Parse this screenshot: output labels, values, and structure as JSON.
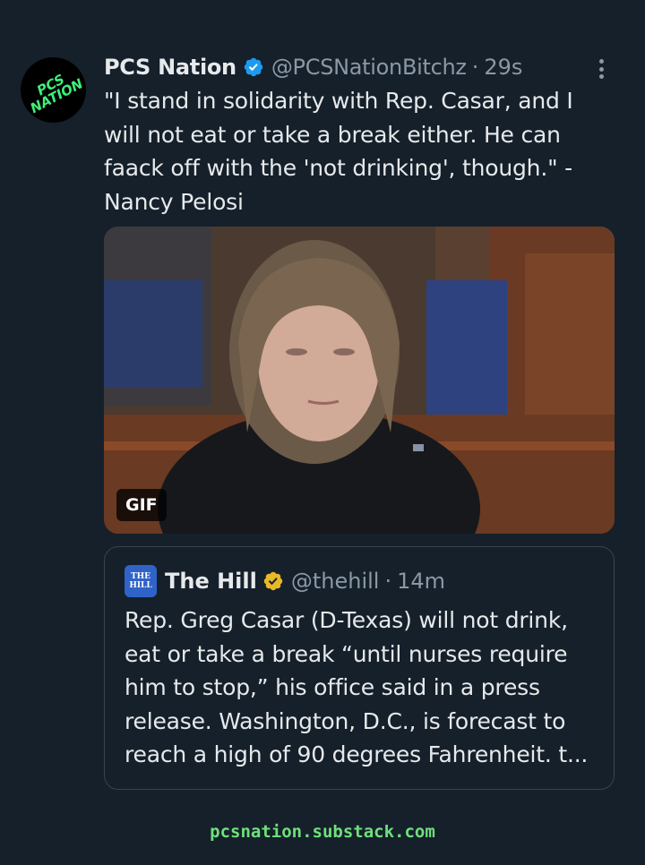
{
  "tweet": {
    "avatar_text": "PCS\nNATION",
    "display_name": "PCS Nation",
    "handle": "@PCSNationBitchz",
    "separator": "·",
    "time": "29s",
    "verified_color": "#1d9bf0",
    "text": "\"I stand in solidarity with Rep. Casar, and I will not eat or take a break either. He can faack off with the 'not drinking', though.\" - Nancy Pelosi",
    "media_badge": "GIF"
  },
  "quoted_tweet": {
    "avatar_text_top": "THE",
    "avatar_text_bottom": "HILL",
    "display_name": "The Hill",
    "handle": "@thehill",
    "separator": "·",
    "time": "14m",
    "verified_color": "#e8b829",
    "text": "Rep. Greg Casar (D-Texas) will not drink, eat or take a break “until nurses require him to stop,” his office said in a press release. Washington, D.C., is forecast to reach a high of 90 degrees Fahrenheit. t..."
  },
  "footer": {
    "watermark": "pcsnation.substack.com"
  },
  "colors": {
    "background": "#15202b",
    "secondary_text": "#8b98a5",
    "watermark": "#6ee07a"
  }
}
